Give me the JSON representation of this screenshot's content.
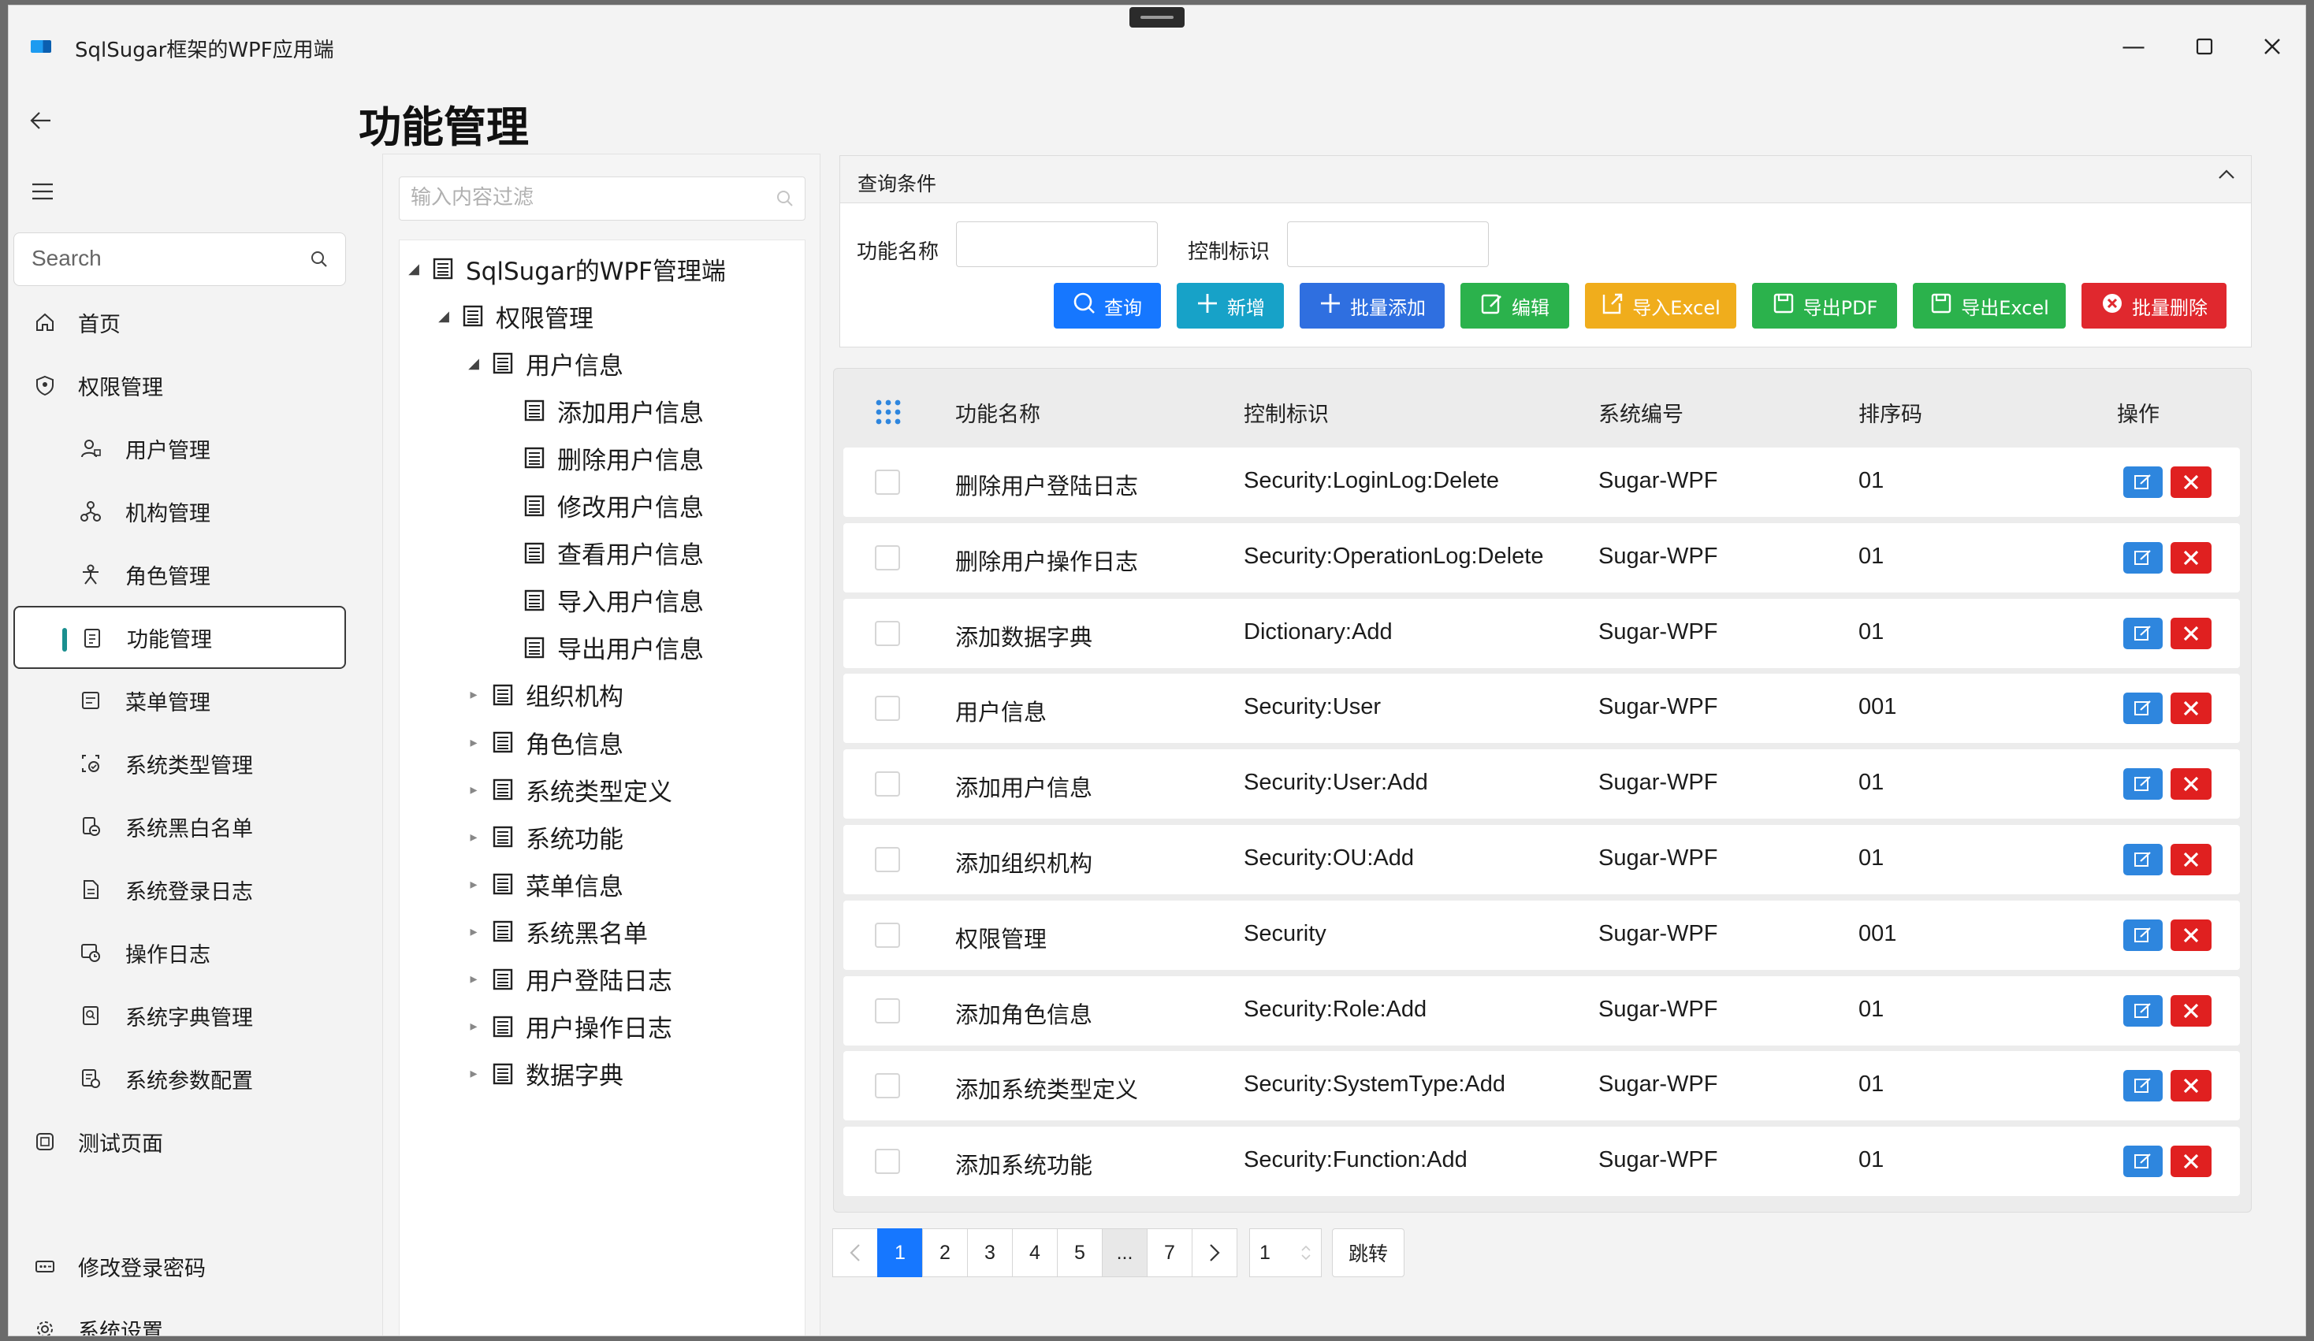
{
  "window": {
    "title": "SqlSugar框架的WPF应用端"
  },
  "sidebar": {
    "search_placeholder": "Search",
    "items": [
      {
        "label": "首页",
        "icon": "home-icon",
        "level": "top"
      },
      {
        "label": "权限管理",
        "icon": "shield-icon",
        "level": "top"
      },
      {
        "label": "用户管理",
        "icon": "user-icon",
        "level": "sub"
      },
      {
        "label": "机构管理",
        "icon": "org-icon",
        "level": "sub"
      },
      {
        "label": "角色管理",
        "icon": "role-icon",
        "level": "sub"
      },
      {
        "label": "功能管理",
        "icon": "clipboard-icon",
        "level": "sub",
        "active": true
      },
      {
        "label": "菜单管理",
        "icon": "menu-list-icon",
        "level": "sub"
      },
      {
        "label": "系统类型管理",
        "icon": "system-type-icon",
        "level": "sub"
      },
      {
        "label": "系统黑白名单",
        "icon": "blacklist-icon",
        "level": "sub"
      },
      {
        "label": "系统登录日志",
        "icon": "login-log-icon",
        "level": "sub"
      },
      {
        "label": "操作日志",
        "icon": "operation-log-icon",
        "level": "sub"
      },
      {
        "label": "系统字典管理",
        "icon": "dictionary-icon",
        "level": "sub"
      },
      {
        "label": "系统参数配置",
        "icon": "config-icon",
        "level": "sub"
      },
      {
        "label": "测试页面",
        "icon": "test-page-icon",
        "level": "top"
      }
    ],
    "bottom_items": [
      {
        "label": "修改登录密码",
        "icon": "password-icon"
      },
      {
        "label": "系统设置",
        "icon": "gear-icon"
      }
    ]
  },
  "page": {
    "title": "功能管理"
  },
  "tree": {
    "filter_placeholder": "输入内容过滤",
    "nodes": [
      {
        "label": "SqlSugar的WPF管理端",
        "depth": 0,
        "expanded": true,
        "has_children": true
      },
      {
        "label": "权限管理",
        "depth": 1,
        "expanded": true,
        "has_children": true
      },
      {
        "label": "用户信息",
        "depth": 2,
        "expanded": true,
        "has_children": true
      },
      {
        "label": "添加用户信息",
        "depth": 3,
        "has_children": false
      },
      {
        "label": "删除用户信息",
        "depth": 3,
        "has_children": false
      },
      {
        "label": "修改用户信息",
        "depth": 3,
        "has_children": false
      },
      {
        "label": "查看用户信息",
        "depth": 3,
        "has_children": false
      },
      {
        "label": "导入用户信息",
        "depth": 3,
        "has_children": false
      },
      {
        "label": "导出用户信息",
        "depth": 3,
        "has_children": false
      },
      {
        "label": "组织机构",
        "depth": 2,
        "expanded": false,
        "has_children": true
      },
      {
        "label": "角色信息",
        "depth": 2,
        "expanded": false,
        "has_children": true
      },
      {
        "label": "系统类型定义",
        "depth": 2,
        "expanded": false,
        "has_children": true
      },
      {
        "label": "系统功能",
        "depth": 2,
        "expanded": false,
        "has_children": true
      },
      {
        "label": "菜单信息",
        "depth": 2,
        "expanded": false,
        "has_children": true
      },
      {
        "label": "系统黑名单",
        "depth": 2,
        "expanded": false,
        "has_children": true
      },
      {
        "label": "用户登陆日志",
        "depth": 2,
        "expanded": false,
        "has_children": true
      },
      {
        "label": "用户操作日志",
        "depth": 2,
        "expanded": false,
        "has_children": true
      },
      {
        "label": "数据字典",
        "depth": 2,
        "expanded": false,
        "has_children": true
      }
    ]
  },
  "query": {
    "title": "查询条件",
    "fields": [
      {
        "label": "功能名称",
        "value": ""
      },
      {
        "label": "控制标识",
        "value": ""
      }
    ],
    "buttons": [
      {
        "label": "查询",
        "icon": "search-icon",
        "color": "#1677ff"
      },
      {
        "label": "新增",
        "icon": "plus-icon",
        "color": "#17a2c8"
      },
      {
        "label": "批量添加",
        "icon": "plus-icon",
        "color": "#2f6fe0"
      },
      {
        "label": "编辑",
        "icon": "edit-icon",
        "color": "#2bb24c"
      },
      {
        "label": "导入Excel",
        "icon": "import-icon",
        "color": "#f0ad1c"
      },
      {
        "label": "导出PDF",
        "icon": "save-icon",
        "color": "#2bb24c"
      },
      {
        "label": "导出Excel",
        "icon": "save-icon",
        "color": "#2bb24c"
      },
      {
        "label": "批量删除",
        "icon": "close-circle-icon",
        "color": "#e0282e"
      }
    ]
  },
  "grid": {
    "columns": [
      "功能名称",
      "控制标识",
      "系统编号",
      "排序码",
      "操作"
    ],
    "rows": [
      [
        "删除用户登陆日志",
        "Security:LoginLog:Delete",
        "Sugar-WPF",
        "01"
      ],
      [
        "删除用户操作日志",
        "Security:OperationLog:Delete",
        "Sugar-WPF",
        "01"
      ],
      [
        "添加数据字典",
        "Dictionary:Add",
        "Sugar-WPF",
        "01"
      ],
      [
        "用户信息",
        "Security:User",
        "Sugar-WPF",
        "001"
      ],
      [
        "添加用户信息",
        "Security:User:Add",
        "Sugar-WPF",
        "01"
      ],
      [
        "添加组织机构",
        "Security:OU:Add",
        "Sugar-WPF",
        "01"
      ],
      [
        "权限管理",
        "Security",
        "Sugar-WPF",
        "001"
      ],
      [
        "添加角色信息",
        "Security:Role:Add",
        "Sugar-WPF",
        "01"
      ],
      [
        "添加系统类型定义",
        "Security:SystemType:Add",
        "Sugar-WPF",
        "01"
      ],
      [
        "添加系统功能",
        "Security:Function:Add",
        "Sugar-WPF",
        "01"
      ]
    ]
  },
  "pager": {
    "pages": [
      "1",
      "2",
      "3",
      "4",
      "5",
      "...",
      "7"
    ],
    "current_page": "1",
    "jump_value": "1",
    "jump_label": "跳转"
  }
}
